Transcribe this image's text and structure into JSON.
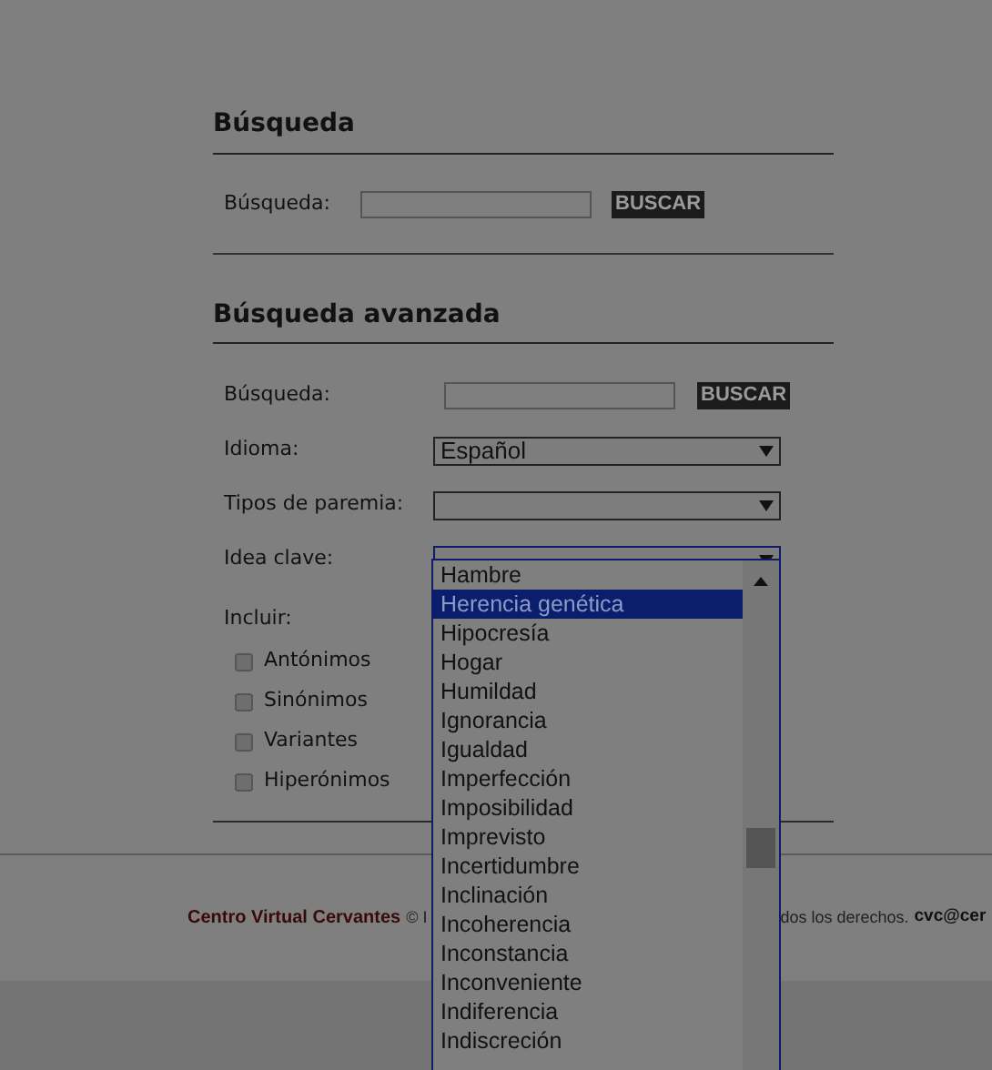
{
  "search": {
    "title": "Búsqueda",
    "label": "Búsqueda:",
    "button": "BUSCAR"
  },
  "advanced": {
    "title": "Búsqueda avanzada",
    "fields": [
      {
        "kind": "text",
        "label": "Búsqueda:",
        "button": "BUSCAR"
      },
      {
        "kind": "select",
        "label": "Idioma:",
        "value": "Español",
        "focused": false
      },
      {
        "kind": "select",
        "label": "Tipos de paremia:",
        "focused": false
      },
      {
        "kind": "select",
        "label": "Idea clave:",
        "focused": true
      }
    ],
    "include": {
      "label": "Incluir:",
      "options": [
        {
          "label": "Antónimos",
          "checked": false
        },
        {
          "label": "Sinónimos",
          "checked": false
        },
        {
          "label": "Variantes",
          "checked": false
        },
        {
          "label": "Hiperónimos",
          "checked": false
        }
      ]
    }
  },
  "dropdown": {
    "items": [
      {
        "label": "Hambre",
        "selected": false
      },
      {
        "label": "Herencia genética",
        "selected": true
      },
      {
        "label": "Hipocresía",
        "selected": false
      },
      {
        "label": "Hogar",
        "selected": false
      },
      {
        "label": "Humildad",
        "selected": false
      },
      {
        "label": "Ignorancia",
        "selected": false
      },
      {
        "label": "Igualdad",
        "selected": false
      },
      {
        "label": "Imperfección",
        "selected": false
      },
      {
        "label": "Imposibilidad",
        "selected": false
      },
      {
        "label": "Imprevisto",
        "selected": false
      },
      {
        "label": "Incertidumbre",
        "selected": false
      },
      {
        "label": "Inclinación",
        "selected": false
      },
      {
        "label": "Incoherencia",
        "selected": false
      },
      {
        "label": "Inconstancia",
        "selected": false
      },
      {
        "label": "Inconveniente",
        "selected": false
      },
      {
        "label": "Indiferencia",
        "selected": false
      },
      {
        "label": "Indiscreción",
        "selected": false
      }
    ]
  },
  "footer": {
    "brand": "Centro Virtual Cervantes",
    "notice": "© I",
    "rights": "dos los derechos.",
    "email": "cvc@cer"
  }
}
